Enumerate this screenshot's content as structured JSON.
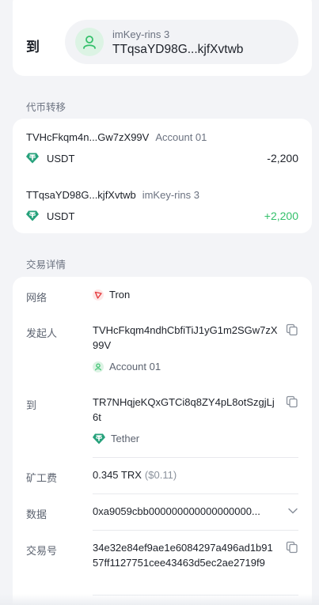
{
  "to_card": {
    "label": "到",
    "recipient_name": "imKey-rins 3",
    "recipient_address": "TTqsaYD98G...kjfXvtwb"
  },
  "token_transfer": {
    "section_title": "代币转移",
    "rows": [
      {
        "address": "TVHcFkqm4n...Gw7zX99V",
        "account": "Account 01",
        "token": "USDT",
        "amount": "-2,200"
      },
      {
        "address": "TTqsaYD98G...kjfXvtwb",
        "account": "imKey-rins 3",
        "token": "USDT",
        "amount": "+2,200"
      }
    ]
  },
  "details": {
    "section_title": "交易详情",
    "network_label": "网络",
    "network_value": "Tron",
    "from_label": "发起人",
    "from_address": "TVHcFkqm4ndhCbfiTiJ1yG1m2SGw7zX99V",
    "from_account": "Account 01",
    "to_label": "到",
    "to_address": "TR7NHqjeKQxGTCi8q8ZY4pL8otSzgjLj6t",
    "to_token": "Tether",
    "fee_label": "矿工费",
    "fee_value": "0.345 TRX",
    "fee_fiat": "($0.11)",
    "data_label": "数据",
    "data_value": "0xa9059cbb000000000000000000...",
    "txid_label": "交易号",
    "txid_value": "34e32e84ef9ae1e6084297a496ad1b9157ff1127751cee43463d5ec2ae2719f9"
  },
  "colors": {
    "accent_green": "#34c06b",
    "tron_red": "#e5383b",
    "tether_teal": "#26a17b",
    "background": "#f3f4f7"
  },
  "icons": {
    "avatar": "user-icon",
    "usdt": "tether-icon",
    "network": "tron-icon",
    "copy": "copy-icon",
    "expand": "chevron-down-icon"
  }
}
